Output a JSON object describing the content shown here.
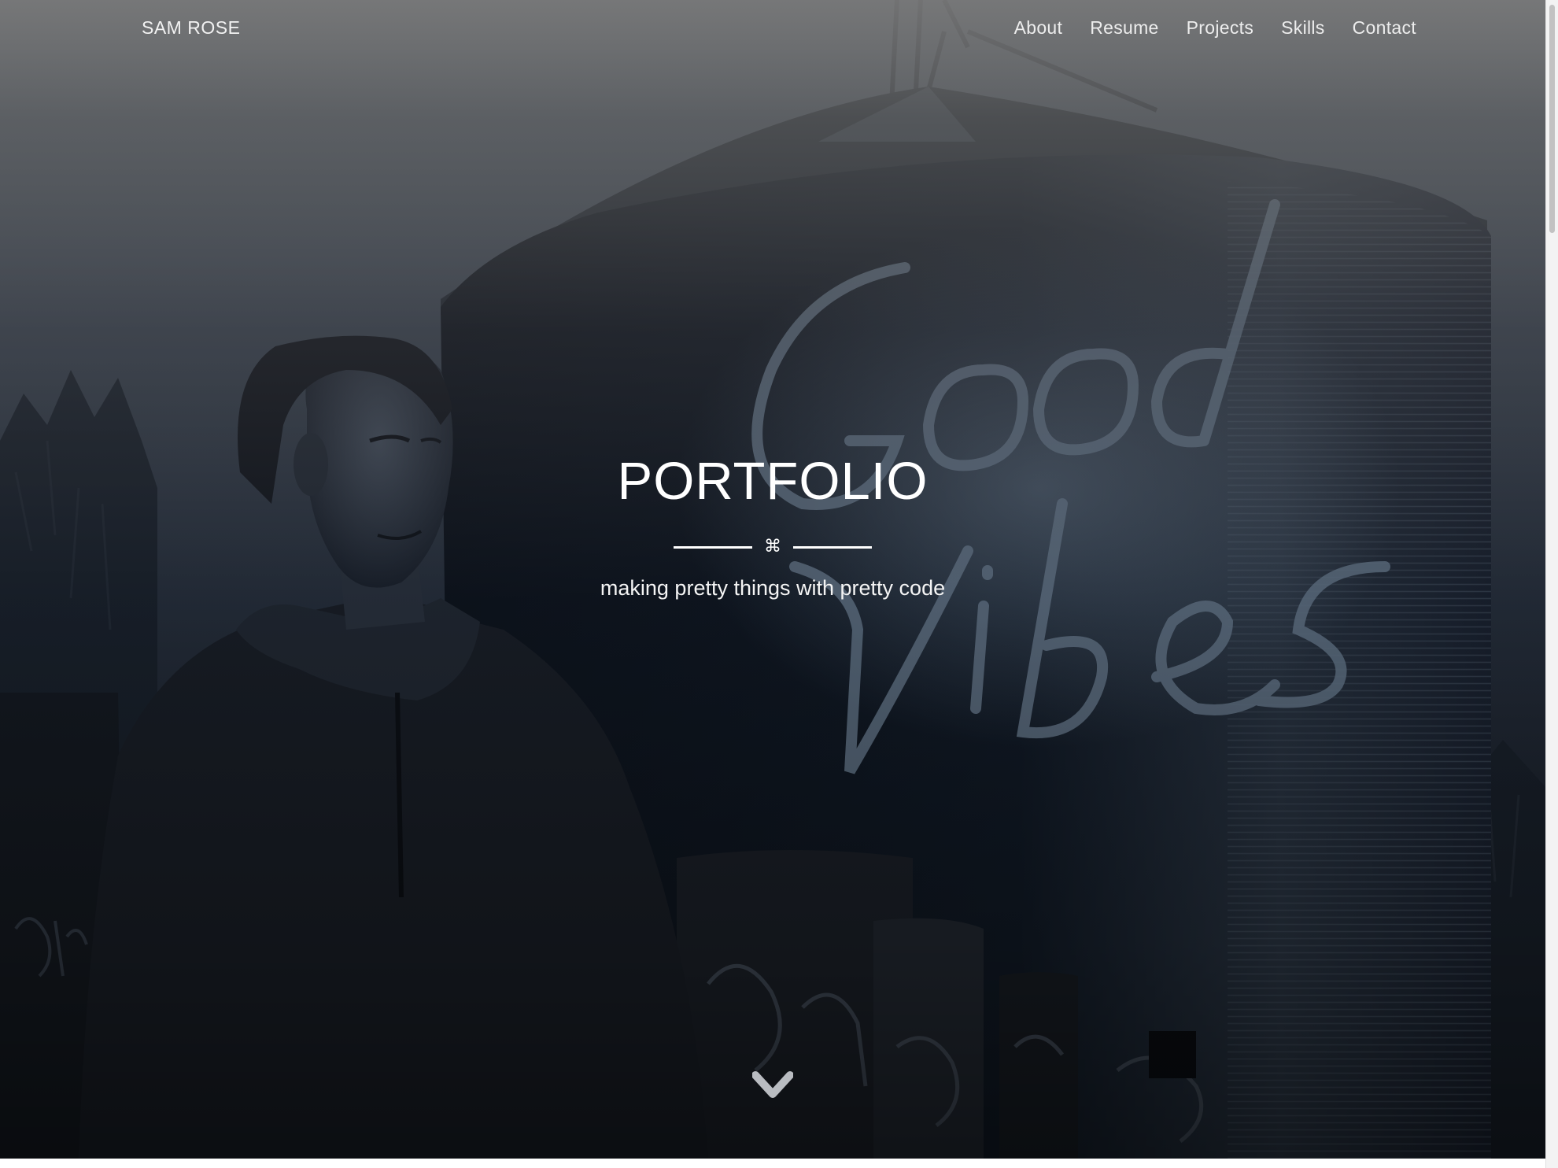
{
  "navbar": {
    "brand": "SAM ROSE",
    "links": [
      {
        "label": "About"
      },
      {
        "label": "Resume"
      },
      {
        "label": "Projects"
      },
      {
        "label": "Skills"
      },
      {
        "label": "Contact"
      }
    ]
  },
  "hero": {
    "title": "PORTFOLIO",
    "divider_icon": "⌘",
    "subtitle": "making pretty things with pretty code",
    "scroll_icon": "chevron-down-icon"
  },
  "background_photo": {
    "mural_lettering": "Good Vibes"
  },
  "colors": {
    "text": "#ffffff",
    "nav_text": "#ededed",
    "hero_bg": "#0a0f18",
    "mural": "#6f8296"
  }
}
